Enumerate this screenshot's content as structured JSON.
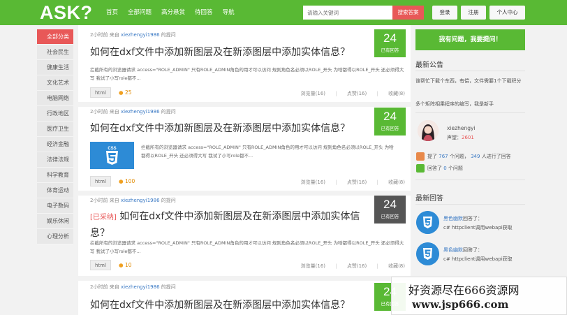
{
  "header": {
    "logo": "ASK?",
    "nav": [
      "首页",
      "全部问题",
      "高分悬赏",
      "待回答",
      "导航"
    ],
    "search_placeholder": "请输入关键词",
    "search_button": "搜索答案",
    "login": "登录",
    "register": "注册",
    "user_center": "个人中心"
  },
  "sidebar": {
    "items": [
      "全部分类",
      "社会民生",
      "健康生活",
      "文化艺术",
      "电脑网络",
      "行政地区",
      "医疗卫生",
      "经济金融",
      "法律法规",
      "科学教育",
      "体育运动",
      "电子数码",
      "娱乐休闲",
      "心理分析"
    ]
  },
  "questions": [
    {
      "time": "2小时前",
      "from": "来自",
      "user": "xiezhengyi1986",
      "suffix": "的提问",
      "tag": "",
      "title": "如何在dxf文件中添加新图层及在新添图层中添加实体信息？",
      "excerpt": "拦截所有的浏览器请求 access=\"ROLE_ADMIN\" 只有ROLE_ADMIN角色的用才可以访问 规则角色名必须以ROLE_开头 为啥都得以ROLE_开头 还必须得大写 我试了小写role都不...",
      "chip": "html",
      "coins": "25",
      "views": "浏览量(16)",
      "likes": "点赞(16)",
      "favorites": "收藏(8)",
      "answers": "24",
      "answers_label": "已有回答"
    },
    {
      "time": "2小时前",
      "from": "来自",
      "user": "xiezhengyi1986",
      "suffix": "的提问",
      "tag": "",
      "title": "如何在dxf文件中添加新图层及在新添图层中添加实体信息？",
      "excerpt": "拦截所有的浏览器请求 access=\"ROLE_ADMIN\" 只有ROLE_ADMIN角色的用才可以访问 规则角色名必须以ROLE_开头 为啥都得以ROLE_开头 还必须得大写 我试了小写role都不...",
      "chip": "html",
      "coins": "100",
      "views": "浏览量(16)",
      "likes": "点赞(16)",
      "favorites": "收藏(8)",
      "answers": "24",
      "answers_label": "已有回答",
      "thumb_text": "CSS"
    },
    {
      "time": "2小时前",
      "from": "来自",
      "user": "xiezhengyi1986",
      "suffix": "的提问",
      "tag": "[已采纳]",
      "title": "如何在dxf文件中添加新图层及在新添图层中添加实体信息？",
      "excerpt": "拦截所有的浏览器请求 access=\"ROLE_ADMIN\" 只有ROLE_ADMIN角色的用才可以访问 规则角色名必须以ROLE_开头 为啥都得以ROLE_开头 还必须得大写 我试了小写role都不...",
      "chip": "html",
      "coins": "10",
      "views": "浏览量(16)",
      "likes": "点赞(16)",
      "favorites": "收藏(8)",
      "answers": "24",
      "answers_label": "已有回答"
    },
    {
      "time": "2小时前",
      "from": "来自",
      "user": "xiezhengyi1986",
      "suffix": "的提问",
      "tag": "",
      "title": "如何在dxf文件中添加新图层及在新添图层中添加实体信息？",
      "answers": "24",
      "answers_label": "已有回答"
    }
  ],
  "right": {
    "ask_button": "我有问题，我要提问！",
    "notice_title": "最新公告",
    "notice_1": "谁帮忙下载个东西，有偿，文件需要1个下载积分",
    "notice_2": "多个矩阵相乘程序的编写，我是新手",
    "profile_name": "xiezhengyi",
    "profile_rep_label": "声望：",
    "profile_rep": "2601",
    "stat1_pre": "提了",
    "stat1_n": "767",
    "stat1_mid": "个问题，",
    "stat1_n2": "349",
    "stat1_post": "人进行了回答",
    "stat2_pre": "回答了",
    "stat2_n": "0",
    "stat2_post": "个问题",
    "latest_title": "最新回答",
    "answers": [
      {
        "user": "黑色幽默",
        "action": "回答了：",
        "text": "c# httpclient调用webapi获取"
      },
      {
        "user": "黑色幽默",
        "action": "回答了：",
        "text": "c# httpclient调用webapi获取"
      }
    ]
  },
  "watermark": {
    "line1": "好资源尽在666资源网",
    "line2": "www.jsp666.com"
  }
}
